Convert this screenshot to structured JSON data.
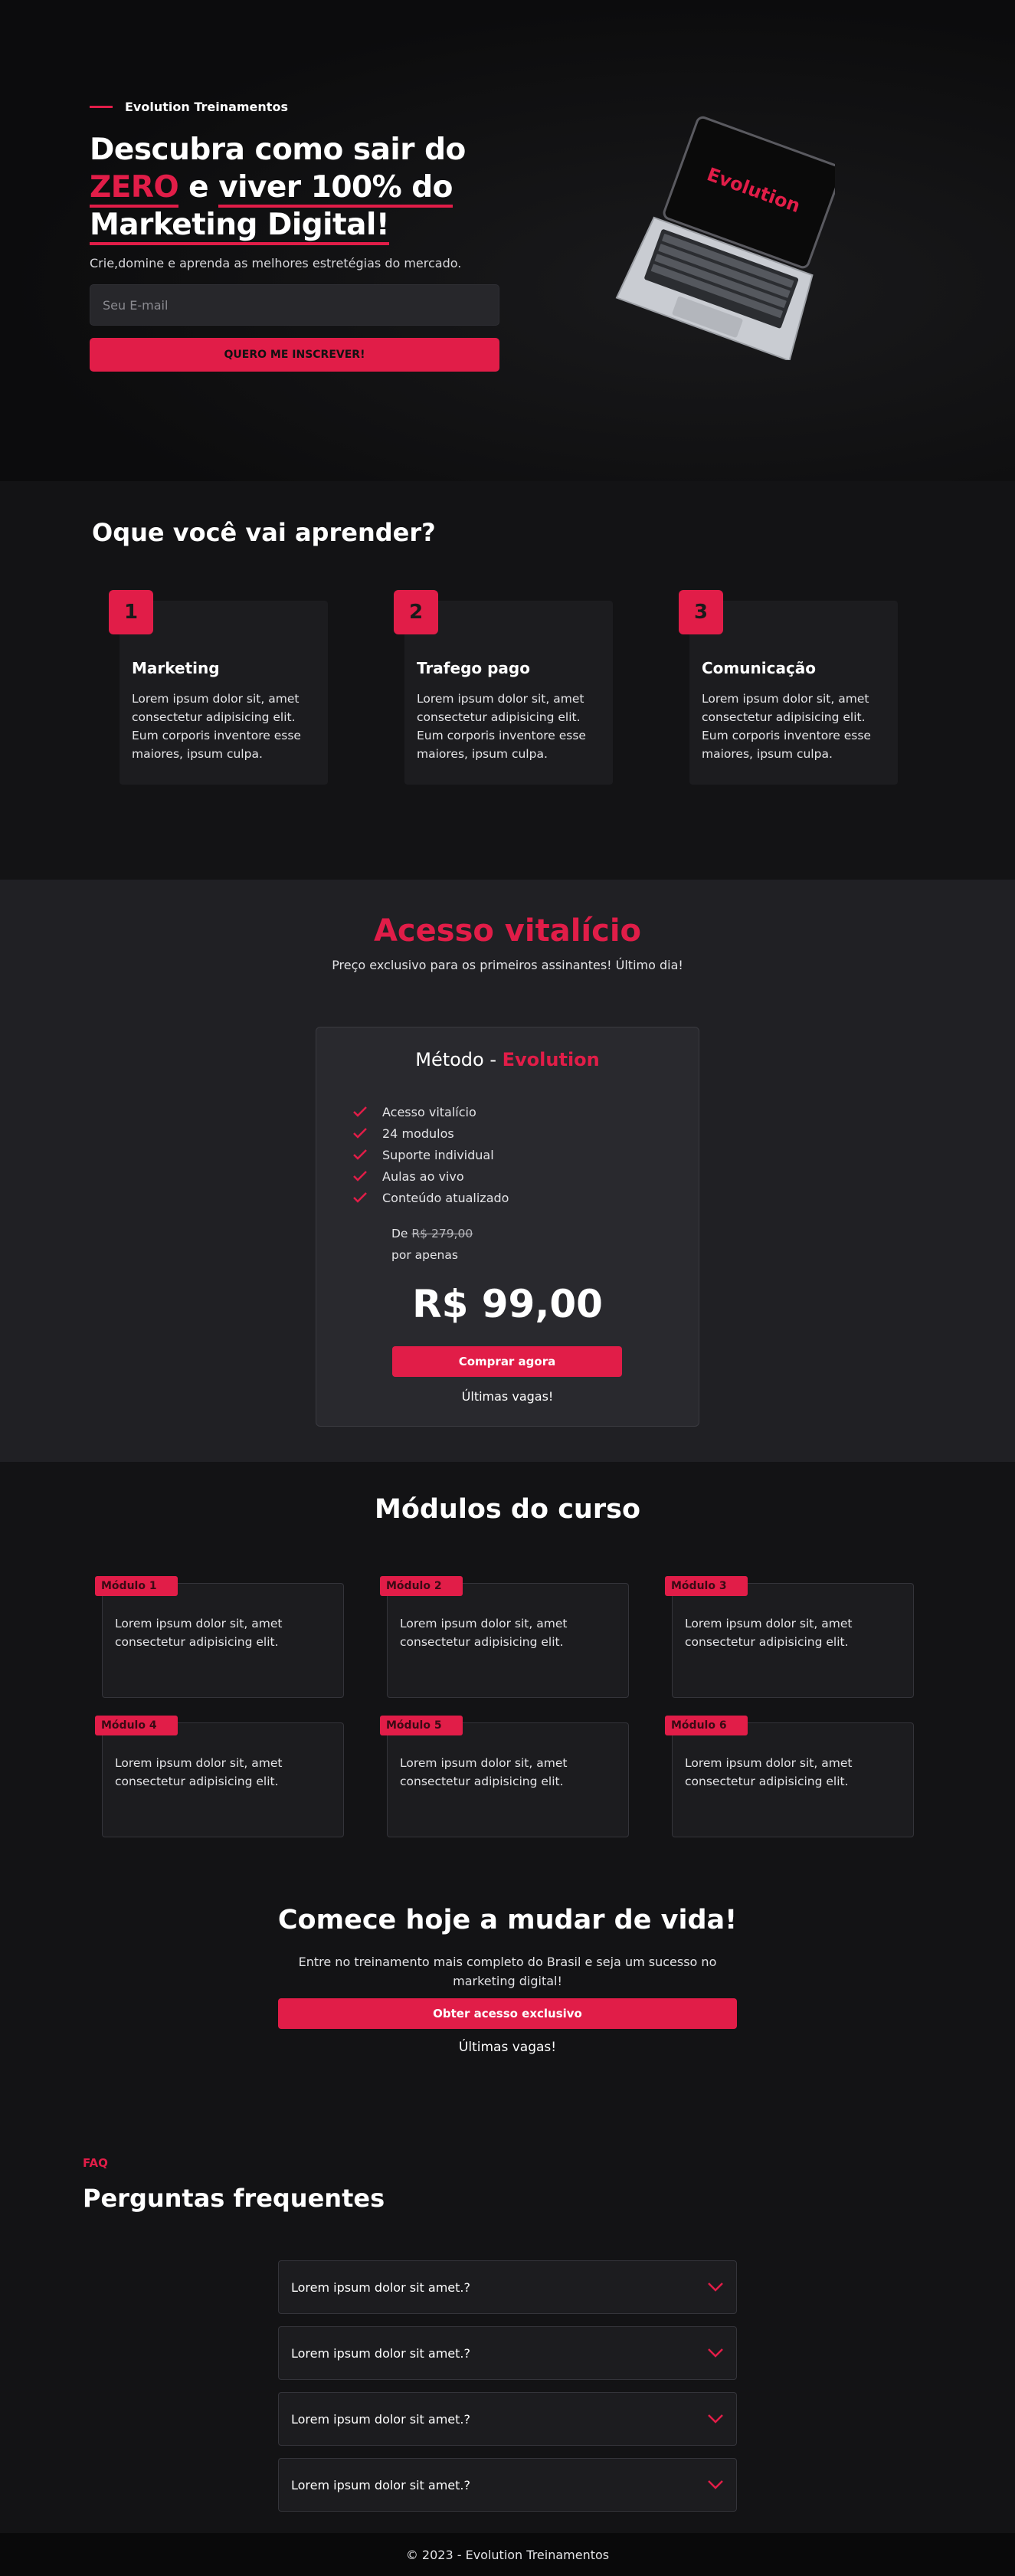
{
  "hero": {
    "brand": "Evolution Treinamentos",
    "title_1": "Descubra como sair do",
    "title_zero": "ZERO",
    "title_and": " e ",
    "title_2": "viver 100% do",
    "title_3": "Marketing Digital!",
    "subtitle": "Crie,domine e aprenda as melhores estretégias do mercado.",
    "email_placeholder": "Seu E-mail",
    "cta": "QUERO ME INSCREVER!",
    "laptop_screen_text": "Evolution"
  },
  "learn": {
    "title": "Oque você vai aprender?",
    "cards": [
      {
        "num": "1",
        "title": "Marketing",
        "text": "Lorem ipsum dolor sit, amet consectetur adipisicing elit. Eum corporis inventore esse maiores, ipsum culpa."
      },
      {
        "num": "2",
        "title": "Trafego pago",
        "text": "Lorem ipsum dolor sit, amet consectetur adipisicing elit. Eum corporis inventore esse maiores, ipsum culpa."
      },
      {
        "num": "3",
        "title": "Comunicação",
        "text": "Lorem ipsum dolor sit, amet consectetur adipisicing elit. Eum corporis inventore esse maiores, ipsum culpa."
      }
    ]
  },
  "pricing": {
    "title": "Acesso vitalício",
    "subtitle": "Preço exclusivo para os primeiros assinantes! Último dia!",
    "plan_prefix": "Método - ",
    "plan_name": "Evolution",
    "features": [
      "Acesso vitalício",
      "24 modulos",
      "Suporte individual",
      "Aulas ao vivo",
      "Conteúdo atualizado"
    ],
    "from_label": "De ",
    "old_price": "R$ 279,00",
    "only_label": "por apenas",
    "price": "R$ 99,00",
    "buy_label": "Comprar agora",
    "last_spots": "Últimas vagas!"
  },
  "modules": {
    "title": "Módulos do curso",
    "items": [
      {
        "tag": "Módulo 1",
        "text": "Lorem ipsum dolor sit, amet consectetur adipisicing elit."
      },
      {
        "tag": "Módulo 2",
        "text": "Lorem ipsum dolor sit, amet consectetur adipisicing elit."
      },
      {
        "tag": "Módulo 3",
        "text": "Lorem ipsum dolor sit, amet consectetur adipisicing elit."
      },
      {
        "tag": "Módulo 4",
        "text": "Lorem ipsum dolor sit, amet consectetur adipisicing elit."
      },
      {
        "tag": "Módulo 5",
        "text": "Lorem ipsum dolor sit, amet consectetur adipisicing elit."
      },
      {
        "tag": "Módulo 6",
        "text": "Lorem ipsum dolor sit, amet consectetur adipisicing elit."
      }
    ]
  },
  "start": {
    "title": "Comece hoje a mudar de vida!",
    "subtitle": "Entre no treinamento mais completo do Brasil e seja um sucesso no marketing digital!",
    "button": "Obter acesso exclusivo",
    "last_spots": "Últimas vagas!"
  },
  "faq": {
    "label": "FAQ",
    "title": "Perguntas frequentes",
    "items": [
      {
        "q": "Lorem ipsum dolor sit amet.?"
      },
      {
        "q": "Lorem ipsum dolor sit amet.?"
      },
      {
        "q": "Lorem ipsum dolor sit amet.?"
      },
      {
        "q": "Lorem ipsum dolor sit amet.?"
      }
    ]
  },
  "footer": {
    "text": "© 2023 - Evolution Treinamentos"
  },
  "colors": {
    "accent": "#e11d48",
    "background": "#131315",
    "card": "#1c1c1f"
  }
}
